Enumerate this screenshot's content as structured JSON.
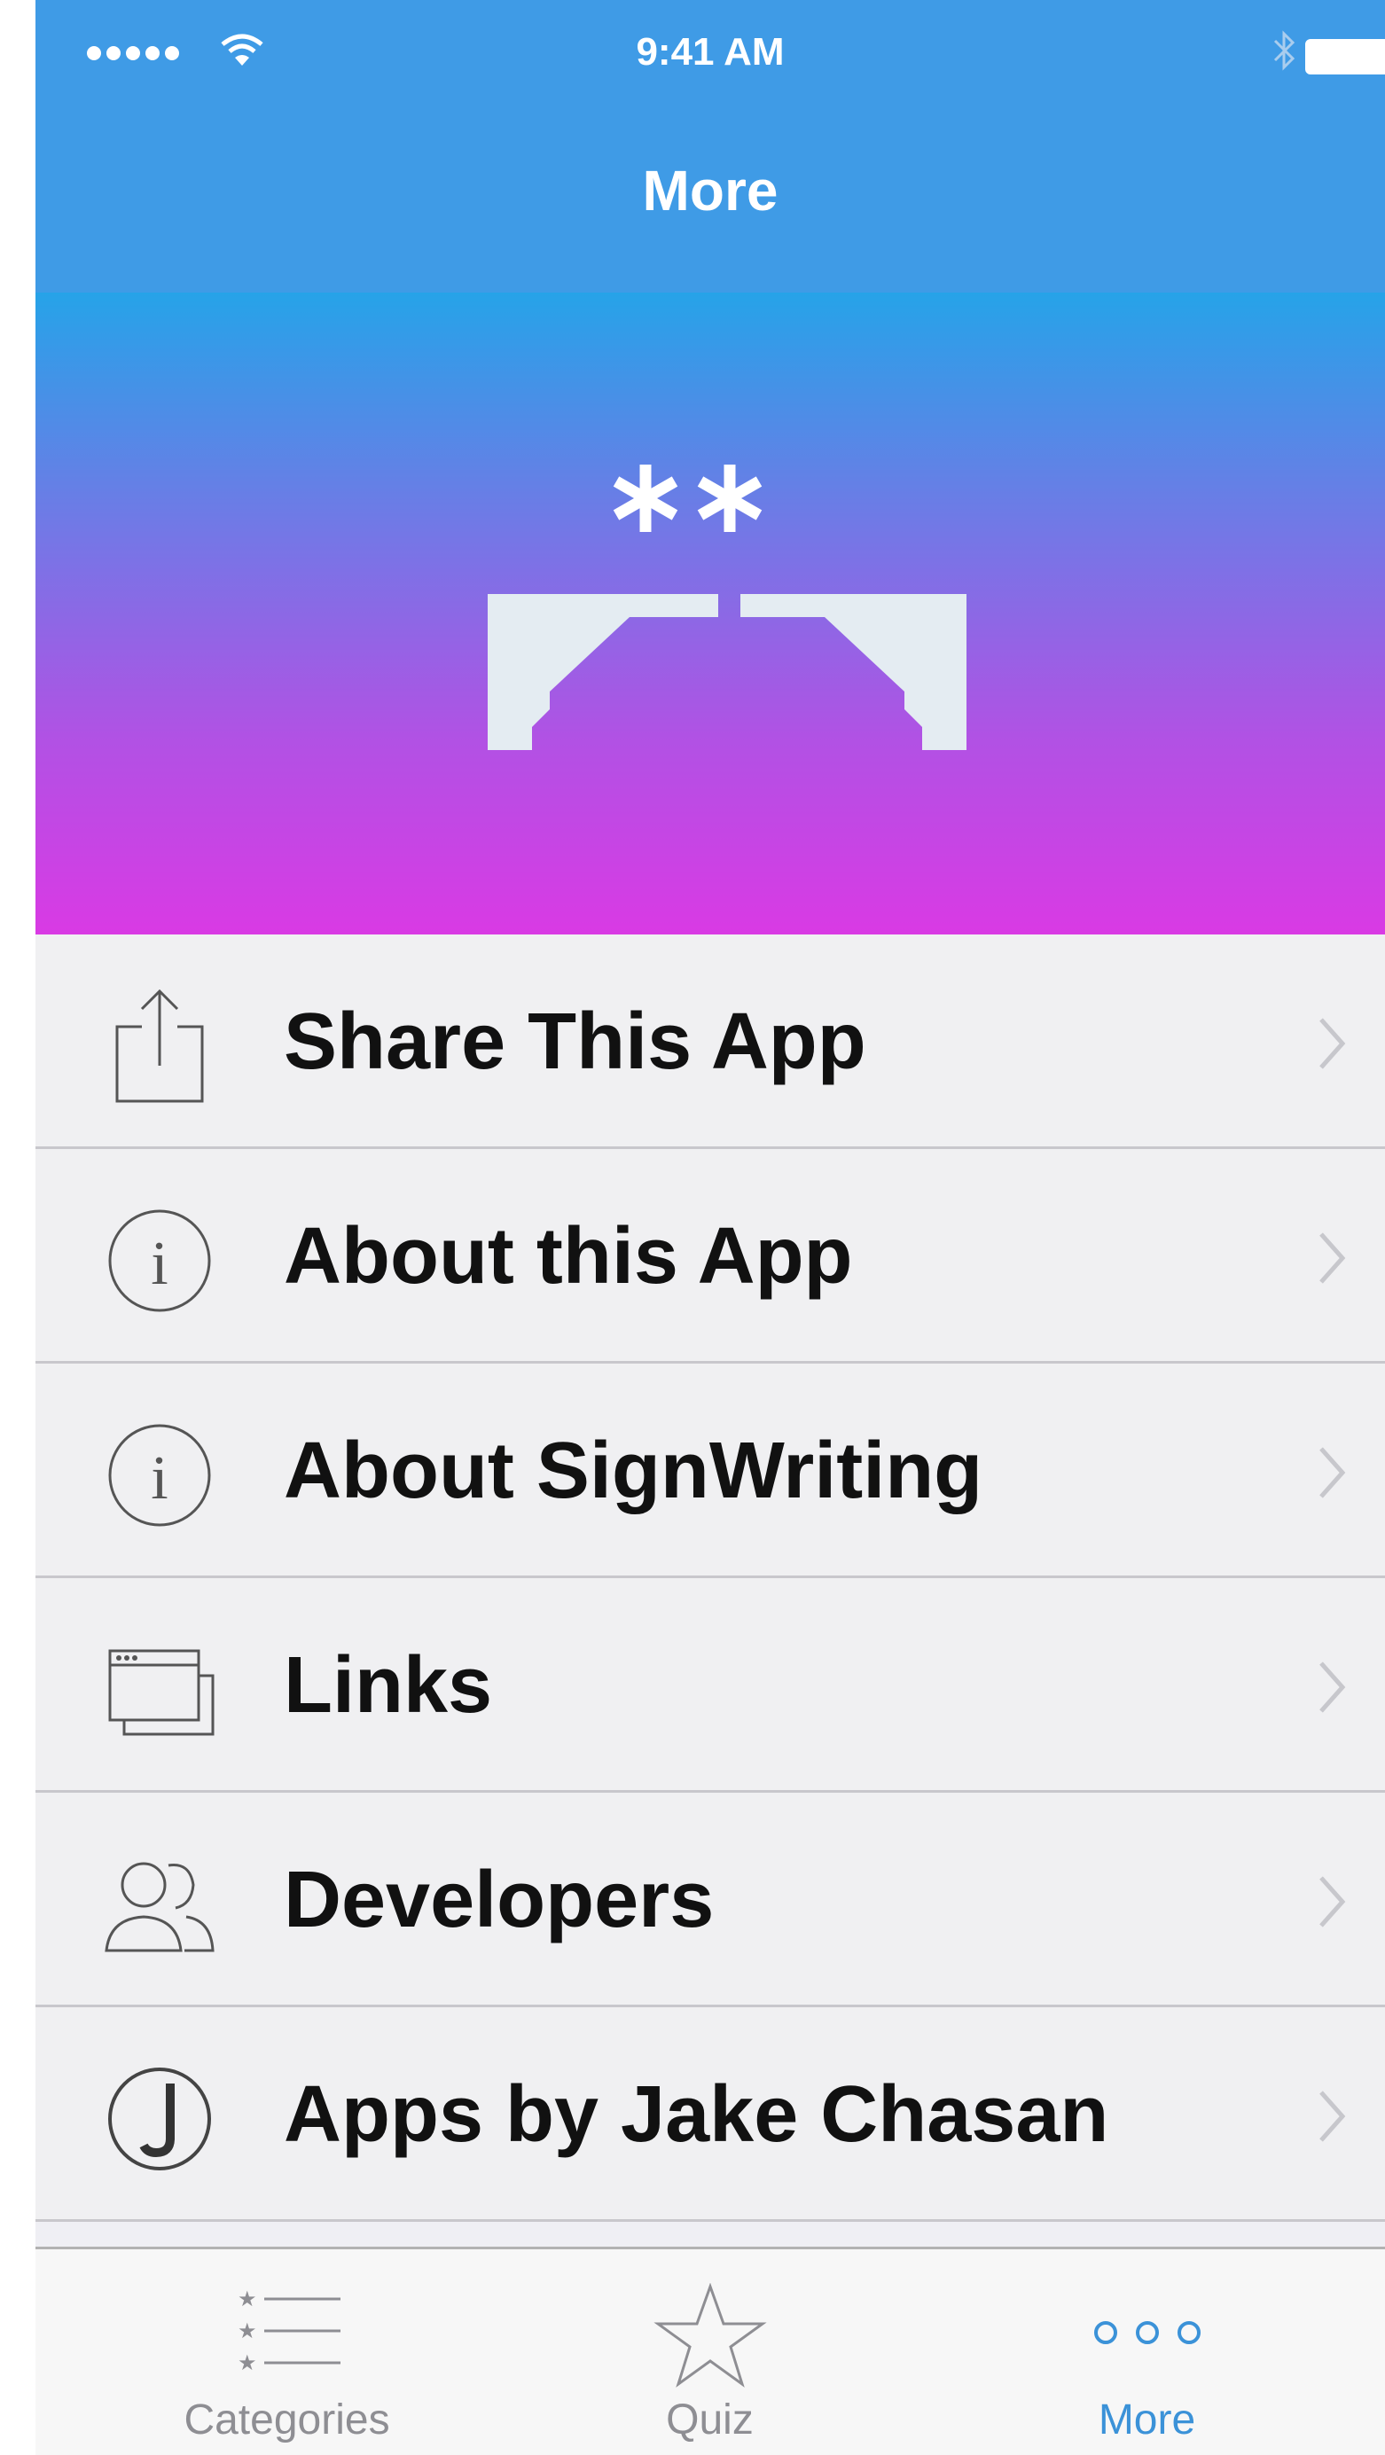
{
  "status_bar": {
    "time": "9:41 AM"
  },
  "nav": {
    "title": "More"
  },
  "menu": {
    "items": [
      {
        "label": "Share This App",
        "icon": "share-icon"
      },
      {
        "label": "About this App",
        "icon": "info-icon"
      },
      {
        "label": "About SignWriting",
        "icon": "info-icon"
      },
      {
        "label": "Links",
        "icon": "browser-windows-icon"
      },
      {
        "label": "Developers",
        "icon": "people-icon"
      },
      {
        "label": "Apps by Jake Chasan",
        "icon": "j-circle-icon"
      }
    ]
  },
  "tabs": {
    "items": [
      {
        "label": "Categories",
        "icon": "starred-list-icon",
        "active": false
      },
      {
        "label": "Quiz",
        "icon": "star-icon",
        "active": false
      },
      {
        "label": "More",
        "icon": "more-dots-icon",
        "active": true
      }
    ]
  },
  "colors": {
    "nav_bar": "#3f9be6",
    "gradient_top": "#26a3e8",
    "gradient_bottom": "#d93ae4",
    "active_tab": "#3b92d8"
  }
}
